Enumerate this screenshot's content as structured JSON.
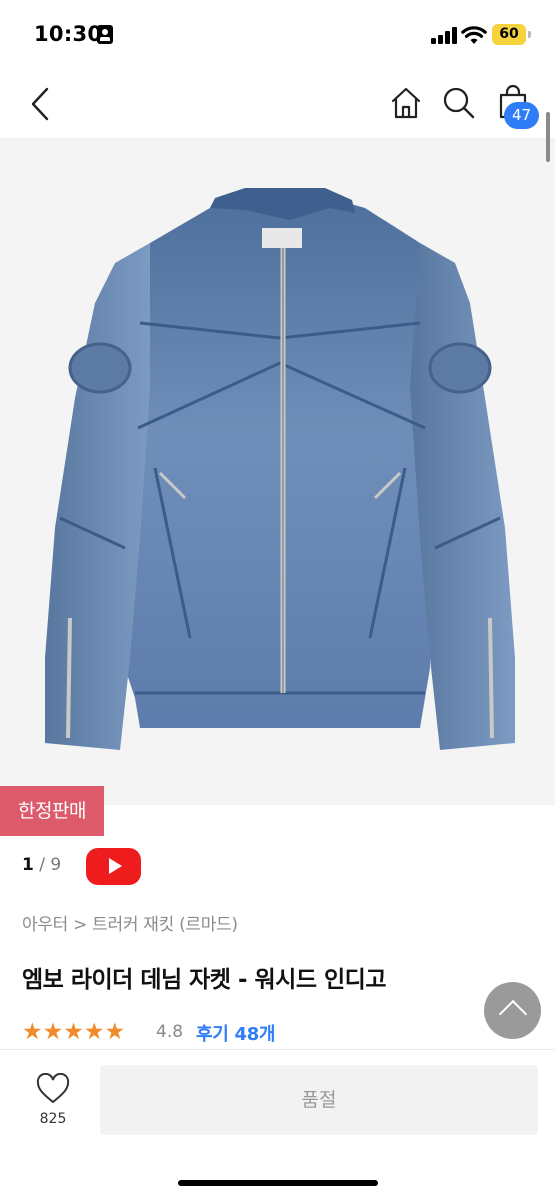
{
  "status_bar": {
    "time": "10:30",
    "battery": "60",
    "icons": [
      "id-card-icon",
      "cellular-signal-icon",
      "wifi-icon",
      "battery-icon"
    ]
  },
  "nav": {
    "icons": [
      "back-chevron-icon",
      "home-icon",
      "search-icon",
      "shopping-bag-icon"
    ],
    "cart_count": "47"
  },
  "product": {
    "image_label": "denim jacket photo",
    "badge": "한정판매",
    "image_index": "1",
    "image_separator": "/",
    "image_total": "9",
    "breadcrumb": "아우터 > 트러커 재킷 (르마드)",
    "title": "엠보 라이더 데님 자켓 - 워시드 인디고",
    "rating_value": 4.8,
    "rating": "4.8",
    "reviews": "후기 48개"
  },
  "bottom_bar": {
    "like_count": "825",
    "soldout_label": "품절"
  },
  "colors": {
    "accent": "#2f7df6",
    "badge": "#dc5a6a",
    "youtube": "#ee1c1c",
    "star": "#f08a2a"
  }
}
